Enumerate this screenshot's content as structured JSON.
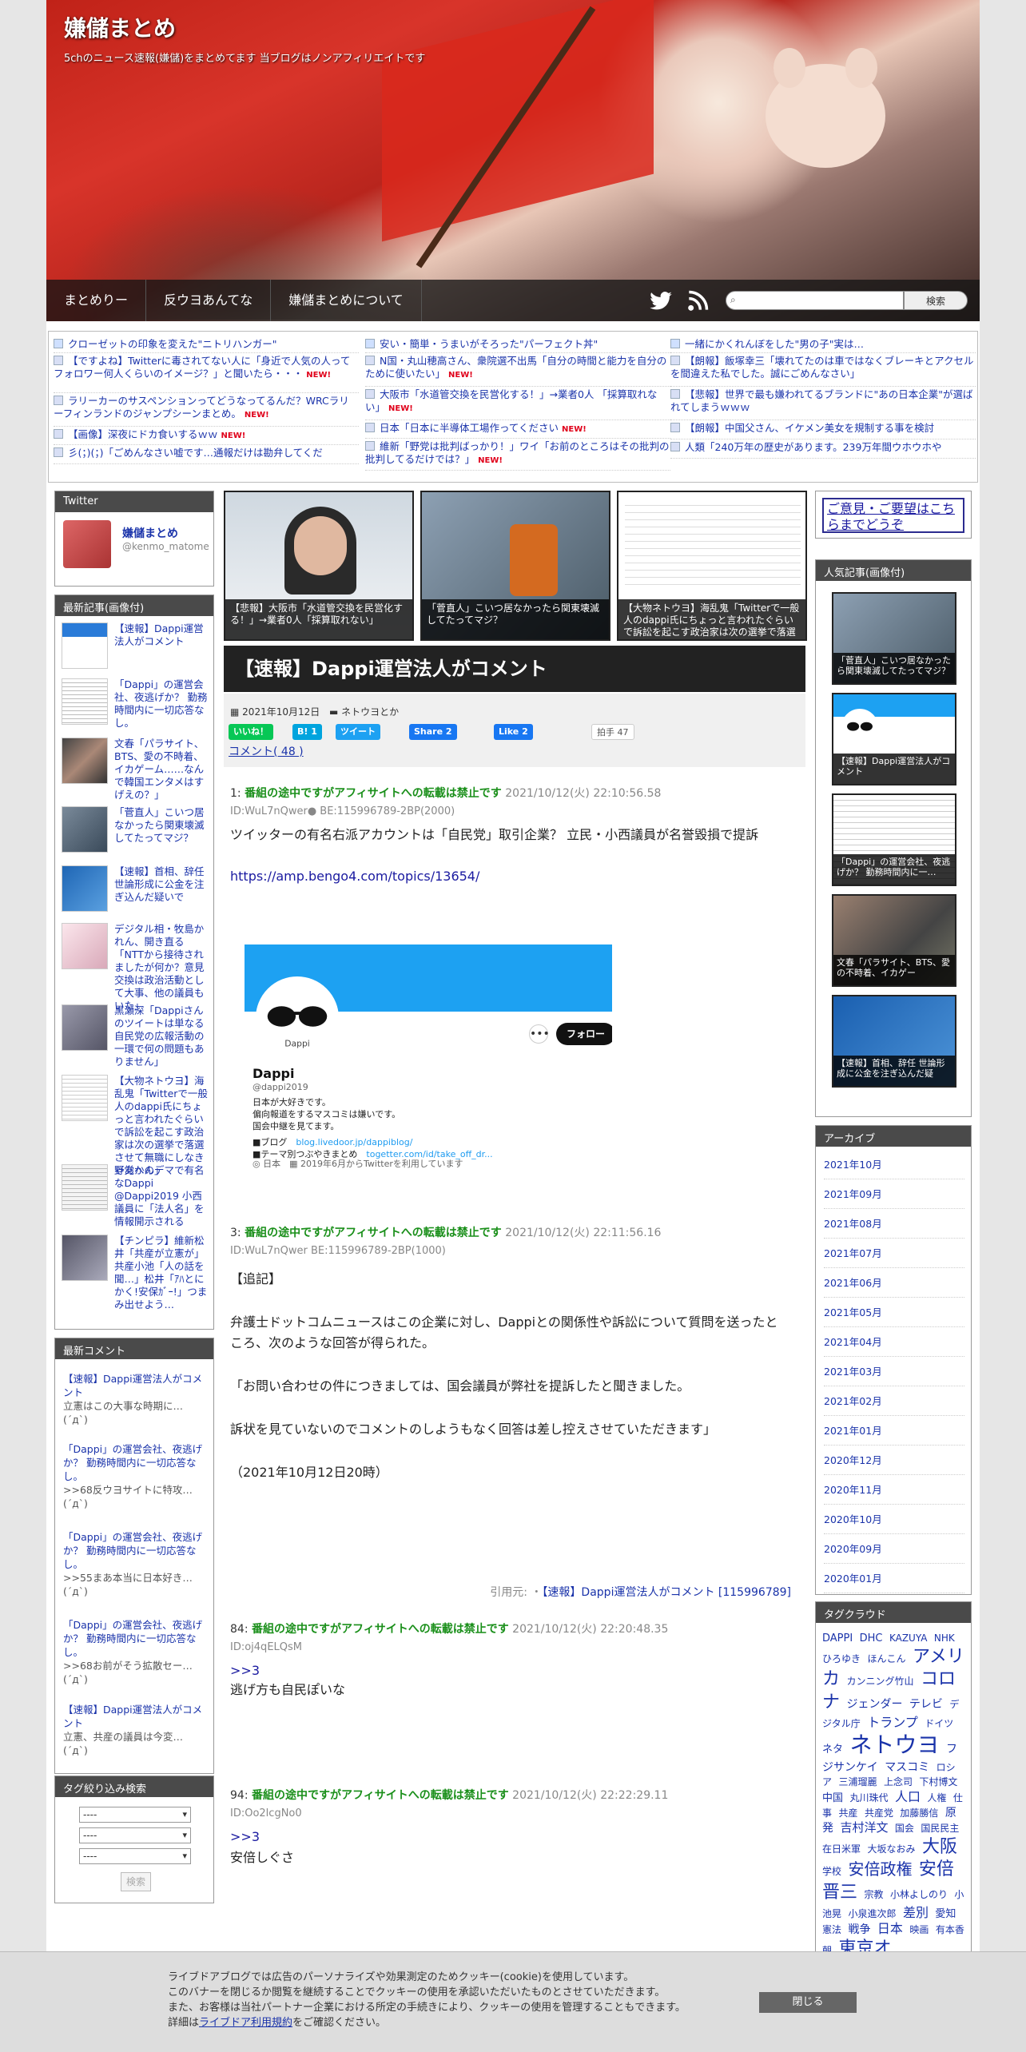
{
  "header": {
    "title": "嫌儲まとめ",
    "description": "5chのニュース速報(嫌儲)をまとめてます 当ブログはノンアフィリエイトです"
  },
  "nav": {
    "items": [
      "まとめりー",
      "反ウヨあんてな",
      "嫌儲まとめについて"
    ],
    "search_button": "検索",
    "search_placeholder": ""
  },
  "headlines": {
    "col1": [
      {
        "text": "クローゼットの印象を変えた\"ニトリハンガー\"",
        "new": false,
        "featured": true
      },
      {
        "text": "【ですよね】Twitterに毒されてない人に「身近で人気の人ってフォロワー何人くらいのイメージ？」と聞いたら・・・",
        "new": true,
        "featured": false
      },
      {
        "text": "ラリーカーのサスペンションってどうなってるんだ？WRCラリーフィンランドのジャンプシーンまとめ。",
        "new": true,
        "featured": false
      },
      {
        "text": "【画像】深夜にドカ食いするｗｗ",
        "new": true,
        "featured": false
      },
      {
        "text": "彡(；)(；)「ごめんなさい嘘です…通報だけは勘弁してくだ",
        "new": false,
        "featured": false
      }
    ],
    "col2": [
      {
        "text": "安い・簡単・うまいがそろった\"パーフェクト丼\"",
        "new": false,
        "featured": true
      },
      {
        "text": "N国・丸山穂高さん、衆院選不出馬「自分の時間と能力を自分のために使いたい」",
        "new": true,
        "featured": false
      },
      {
        "text": "大阪市「水道管交換を民営化する！」→業者0人 「採算取れない」",
        "new": true,
        "featured": false
      },
      {
        "text": "日本「日本に半導体工場作ってください",
        "new": true,
        "featured": false
      },
      {
        "text": "維新「野党は批判ばっかり！」ワイ「お前のところはその批判の批判してるだけでは？」",
        "new": true,
        "featured": false
      }
    ],
    "col3": [
      {
        "text": "一緒にかくれんぼをした\"男の子\"実は…",
        "new": false,
        "featured": true
      },
      {
        "text": "【朗報】飯塚幸三「壊れてたのは車ではなくブレーキとアクセルを間違えた私でした。誠にごめんなさい」",
        "new": false,
        "featured": false
      },
      {
        "text": "【悲報】世界で最も嫌われてるブランドに\"あの日本企業\"が選ばれてしまうｗｗｗ",
        "new": false,
        "featured": false
      },
      {
        "text": "【朗報】中国父さん、イケメン美女を規制する事を検討",
        "new": false,
        "featured": false
      },
      {
        "text": "人類「240万年の歴史があります。239万年間ウホウホや",
        "new": false,
        "featured": false
      }
    ],
    "new_label": "NEW!"
  },
  "twitter": {
    "heading": "Twitter",
    "name": "嫌儲まとめ",
    "handle": "@kenmo_matome"
  },
  "latest": {
    "heading": "最新記事(画像付)",
    "items": [
      "【速報】Dappi運営法人がコメント",
      "「Dappi」の運営会社、夜逃げか？ 勤務時間内に一切応答なし。",
      "文春「パラサイト、BTS、愛の不時着、イカゲーム……なんで韓国エンタメはすげえの？」",
      "「菅直人」こいつ居なかったら関東壊滅してたってマジ？",
      "【速報】首相、辞任 世論形成に公金を注ぎ込んだ疑いで",
      "デジタル相・牧島かれん、開き直る「NTTから接待されましたが何か？意見交換は政治活動として大事、他の議員もいた」",
      "黒瀬深「Dappiさんのツイートは単なる自民党の広報活動の一環で何の問題もありません」",
      "【大物ネトウヨ】海乱鬼「Twitterで一般人のdappi氏にちょっと言われたぐらいで訴訟を起こす政治家は次の選挙で落選させて無職にしなきゃあかん」",
      "野党へのデマで有名なDappi @Dappi2019 小西議員に「法人名」を情報開示される",
      "【チンピラ】維新松井「共産が立憲が」共産小池「人の話を聞…」松井「ｱﾊとにかく!安保ｶﾞｰ!」つまみ出せよう…"
    ]
  },
  "comments": {
    "heading": "最新コメント",
    "items": [
      {
        "title": "【速報】Dappi運営法人がコメント",
        "body": "立憲はこの大事な時期に…",
        "author": "(´д`)"
      },
      {
        "title": "「Dappi」の運営会社、夜逃げか？ 勤務時間内に一切応答なし。",
        "body": ">>68反ウヨサイトに特攻…",
        "author": "(´д`)"
      },
      {
        "title": "「Dappi」の運営会社、夜逃げか？ 勤務時間内に一切応答なし。",
        "body": ">>55まあ本当に日本好き…",
        "author": "(´д`)"
      },
      {
        "title": "「Dappi」の運営会社、夜逃げか？ 勤務時間内に一切応答なし。",
        "body": ">>68お前がそう拡散セー…",
        "author": "(´д`)"
      },
      {
        "title": "【速報】Dappi運営法人がコメント",
        "body": "立憲、共産の議員は今変…",
        "author": "(´д`)"
      }
    ]
  },
  "tagsearch": {
    "heading": "タグ絞り込み検索",
    "options": [
      "----",
      "----",
      "----"
    ],
    "button": "検索"
  },
  "opinion": {
    "text": "ご意見・ご要望はこちらまでどうぞ"
  },
  "popular": {
    "heading": "人気記事(画像付)",
    "items": [
      "「菅直人」こいつ居なかったら関東壊滅してたってマジ？",
      "【速報】Dappi運営法人がコメント",
      "「Dappi」の運営会社、夜逃げか？ 勤務時間内に一…",
      "文春「パラサイト、BTS、愛の不時着、イカゲー",
      "【速報】首相、辞任 世論形成に公金を注ぎ込んだ疑"
    ]
  },
  "archive": {
    "heading": "アーカイブ",
    "items": [
      "2021年10月",
      "2021年09月",
      "2021年08月",
      "2021年07月",
      "2021年06月",
      "2021年05月",
      "2021年04月",
      "2021年03月",
      "2021年02月",
      "2021年01月",
      "2020年12月",
      "2020年11月",
      "2020年10月",
      "2020年09月",
      "2020年01月"
    ]
  },
  "tagcloud": {
    "heading": "タグクラウド",
    "tags": [
      {
        "t": "DAPPI",
        "s": 13
      },
      {
        "t": "DHC",
        "s": 13
      },
      {
        "t": "KAZUYA",
        "s": 12
      },
      {
        "t": "NHK",
        "s": 12
      },
      {
        "t": "ひろゆき",
        "s": 12
      },
      {
        "t": "ほんこん",
        "s": 12
      },
      {
        "t": "アメリカ",
        "s": 22
      },
      {
        "t": "カンニング竹山",
        "s": 12
      },
      {
        "t": "コロナ",
        "s": 22
      },
      {
        "t": "ジェンダー",
        "s": 14
      },
      {
        "t": "テレビ",
        "s": 14
      },
      {
        "t": "デジタル庁",
        "s": 12
      },
      {
        "t": "トランプ",
        "s": 16
      },
      {
        "t": "ドイツ",
        "s": 12
      },
      {
        "t": "ネタ",
        "s": 13
      },
      {
        "t": "ネトウヨ",
        "s": 28
      },
      {
        "t": "フジサンケイ",
        "s": 14
      },
      {
        "t": "マスコミ",
        "s": 14
      },
      {
        "t": "ロシア",
        "s": 12
      },
      {
        "t": "三浦瑠麗",
        "s": 12
      },
      {
        "t": "上念司",
        "s": 12
      },
      {
        "t": "下村博文",
        "s": 12
      },
      {
        "t": "中国",
        "s": 13
      },
      {
        "t": "丸川珠代",
        "s": 12
      },
      {
        "t": "人口",
        "s": 16
      },
      {
        "t": "人権",
        "s": 12
      },
      {
        "t": "仕事",
        "s": 12
      },
      {
        "t": "共産",
        "s": 12
      },
      {
        "t": "共産党",
        "s": 12
      },
      {
        "t": "加藤勝信",
        "s": 12
      },
      {
        "t": "原発",
        "s": 14
      },
      {
        "t": "吉村洋文",
        "s": 15
      },
      {
        "t": "国会",
        "s": 12
      },
      {
        "t": "国民民主",
        "s": 12
      },
      {
        "t": "在日米軍",
        "s": 12
      },
      {
        "t": "大坂なおみ",
        "s": 12
      },
      {
        "t": "大阪",
        "s": 22
      },
      {
        "t": "学校",
        "s": 12
      },
      {
        "t": "安倍政権",
        "s": 20
      },
      {
        "t": "安倍晋三",
        "s": 22
      },
      {
        "t": "宗教",
        "s": 12
      },
      {
        "t": "小林よしのり",
        "s": 12
      },
      {
        "t": "小池晃",
        "s": 12
      },
      {
        "t": "小泉進次郎",
        "s": 12
      },
      {
        "t": "差別",
        "s": 16
      },
      {
        "t": "愛知",
        "s": 13
      },
      {
        "t": "憲法",
        "s": 12
      },
      {
        "t": "戦争",
        "s": 14
      },
      {
        "t": "日本",
        "s": 16
      },
      {
        "t": "映画",
        "s": 12
      },
      {
        "t": "有本香",
        "s": 12
      },
      {
        "t": "朝",
        "s": 12
      },
      {
        "t": "東京オ",
        "s": 22
      }
    ]
  },
  "thumbs": [
    "【悲報】大阪市「水道管交換を民営化する！」→業者0人「採算取れない」",
    "「菅直人」こいつ居なかったら関東壊滅してたってマジ？",
    "【大物ネトウヨ】海乱鬼「Twitterで一般人のdappi氏にちょっと言われたぐらいで訴訟を起こす政治家は次の選挙で落選させて"
  ],
  "article": {
    "title": "【速報】Dappi運営法人がコメント",
    "date": "2021年10月12日",
    "category": "ネトウヨとか",
    "share": {
      "line": "いいね！",
      "hatena": "B! 1",
      "tweet": "ツイート",
      "fbshare": "Share 2",
      "like": "Like 2",
      "hakushu": "拍手",
      "hakushu_count": "47"
    },
    "comment_link": "コメント( 48 )",
    "posts": [
      {
        "num": "1:",
        "name": "番組の途中ですがアフィサイトへの転載は禁止です",
        "time": "2021/10/12(火) 22:10:56.58",
        "id": "ID:WuL7nQwer● BE:115996789-2BP(2000)",
        "lines": [
          "ツイッターの有名右派アカウントは「自民党」取引企業？ 立民・小西議員が名誉毀損で提訴"
        ],
        "link": "https://amp.bengo4.com/topics/13654/"
      },
      {
        "num": "3:",
        "name": "番組の途中ですがアフィサイトへの転載は禁止です",
        "time": "2021/10/12(火) 22:11:56.16",
        "id": "ID:WuL7nQwer BE:115996789-2BP(1000)",
        "lines": [
          "【追記】",
          "弁護士ドットコムニュースはこの企業に対し、Dappiとの関係性や訴訟について質問を送ったところ、次のような回答が得られた。",
          "「お問い合わせの件につきましては、国会議員が弊社を提訴したと聞きました。",
          "訴状を見ていないのでコメントのしようもなく回答は差し控えさせていただきます」",
          "（2021年10月12日20時）"
        ]
      },
      {
        "num": "84:",
        "name": "番組の途中ですがアフィサイトへの転載は禁止です",
        "time": "2021/10/12(火) 22:20:48.35",
        "id": "ID:oj4qELQsM",
        "anchor": ">>3",
        "lines": [
          "逃げ方も自民ぽいな"
        ]
      },
      {
        "num": "94:",
        "name": "番組の途中ですがアフィサイトへの転載は禁止です",
        "time": "2021/10/12(火) 22:22:29.11",
        "id": "ID:Oo2lcgNo0",
        "anchor": ">>3",
        "lines": [
          "安倍しぐさ"
        ]
      }
    ],
    "tweet_card": {
      "name": "Dappi",
      "handle": "@dappi2019",
      "follow": "フォロー",
      "bio1": "日本が大好きです。",
      "bio2": "偏向報道をするマスコミは嫌いです。",
      "bio3": "国会中継を見てます。",
      "blog_label": "■ブログ",
      "blog": "blog.livedoor.jp/dappiblog/",
      "theme_label": "■テーマ別つぶやきまとめ",
      "theme": "togetter.com/id/take_off_dr...",
      "location": "日本",
      "joined": "2019年6月からTwitterを利用しています",
      "pic_text": "Dappi"
    },
    "cite_label": "引用元: ・",
    "cite_link": "【速報】Dappi運営法人がコメント [115996789]"
  },
  "cookie": {
    "line1": "ライブドアブログでは広告のパーソナライズや効果測定のためクッキー(cookie)を使用しています。",
    "line2": "このバナーを閉じるか閲覧を継続することでクッキーの使用を承認いただいたものとさせていただきます。",
    "line3": "また、お客様は当社パートナー企業における所定の手続きにより、クッキーの使用を管理することもできます。",
    "line4_pre": "詳細は",
    "line4_link": "ライブドア利用規約",
    "line4_post": "をご確認ください。",
    "close": "閉じる"
  },
  "colors": {
    "accent": "#1a33aa",
    "resname": "#1a8f1a",
    "new": "#e0001a",
    "title_bg": "#222222"
  }
}
